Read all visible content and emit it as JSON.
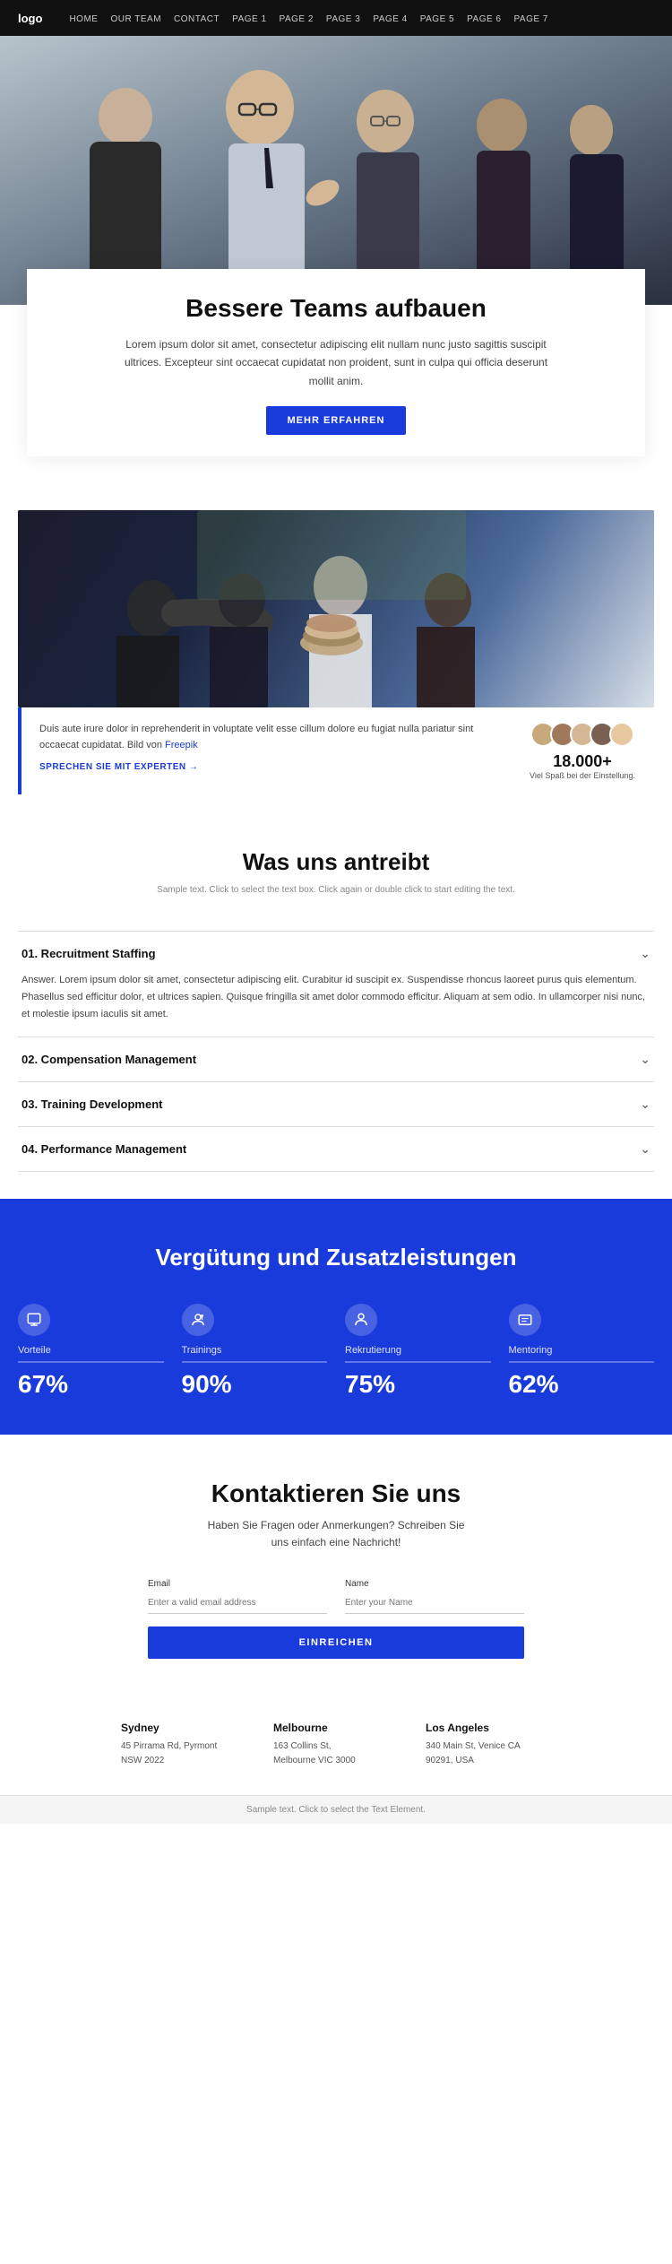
{
  "navbar": {
    "logo": "logo",
    "links": [
      {
        "id": "home",
        "label": "HOME"
      },
      {
        "id": "our-team",
        "label": "OUR TEAM"
      },
      {
        "id": "contact",
        "label": "CONTACT"
      },
      {
        "id": "page1",
        "label": "PAGE 1"
      },
      {
        "id": "page2",
        "label": "PAGE 2"
      },
      {
        "id": "page3",
        "label": "PAGE 3"
      },
      {
        "id": "page4",
        "label": "PAGE 4"
      },
      {
        "id": "page5",
        "label": "PAGE 5"
      },
      {
        "id": "page6",
        "label": "PAGE 6"
      },
      {
        "id": "page7",
        "label": "PAGE 7"
      }
    ]
  },
  "hero": {
    "title": "Bessere Teams aufbauen",
    "description": "Lorem ipsum dolor sit amet, consectetur adipiscing elit nullam nunc justo sagittis suscipit ultrices. Excepteur sint occaecat cupidatat non proident, sunt in culpa qui officia deserunt mollit anim.",
    "cta_button": "MEHR ERFAHREN"
  },
  "teamwork": {
    "stats_text": "Duis aute irure dolor in reprehenderit in voluptate velit esse cillum dolore eu fugiat nulla pariatur sint occaecat cupidatat. Bild von ",
    "stats_link_text": "Freepik",
    "cta_link": "SPRECHEN SIE MIT EXPERTEN →",
    "number": "18.000+",
    "number_label": "Viel Spaß bei der Einstellung."
  },
  "was_section": {
    "title": "Was uns antreibt",
    "sample_text": "Sample text. Click to select the text box. Click again or double click to start editing the text.",
    "accordion": [
      {
        "id": "item1",
        "title": "01. Recruitment Staffing",
        "open": true,
        "body": "Answer. Lorem ipsum dolor sit amet, consectetur adipiscing elit. Curabitur id suscipit ex. Suspendisse rhoncus laoreet purus quis elementum. Phasellus sed efficitur dolor, et ultrices sapien. Quisque fringilla sit amet dolor commodo efficitur. Aliquam at sem odio. In ullamcorper nisi nunc, et molestie ipsum iaculis sit amet."
      },
      {
        "id": "item2",
        "title": "02. Compensation Management",
        "open": false,
        "body": ""
      },
      {
        "id": "item3",
        "title": "03. Training Development",
        "open": false,
        "body": ""
      },
      {
        "id": "item4",
        "title": "04. Performance Management",
        "open": false,
        "body": ""
      }
    ]
  },
  "benefits": {
    "title": "Vergütung und Zusatzleistungen",
    "items": [
      {
        "id": "vorteile",
        "label": "Vorteile",
        "percent": "67%",
        "icon": "check"
      },
      {
        "id": "trainings",
        "label": "Trainings",
        "percent": "90%",
        "icon": "training"
      },
      {
        "id": "rekrutierung",
        "label": "Rekrutierung",
        "percent": "75%",
        "icon": "person"
      },
      {
        "id": "mentoring",
        "label": "Mentoring",
        "percent": "62%",
        "icon": "mentoring"
      }
    ]
  },
  "contact": {
    "title": "Kontaktieren Sie uns",
    "subtitle": "Haben Sie Fragen oder Anmerkungen? Schreiben Sie uns einfach eine Nachricht!",
    "email_label": "Email",
    "email_placeholder": "Enter a valid email address",
    "name_label": "Name",
    "name_placeholder": "Enter your Name",
    "submit_button": "EINREICHEN",
    "offices": [
      {
        "city": "Sydney",
        "address": "45 Pirrama Rd, Pyrmont\nNSW 2022"
      },
      {
        "city": "Melbourne",
        "address": "163 Collins St,\nMelbourne VIC 3000"
      },
      {
        "city": "Los Angeles",
        "address": "340 Main St, Venice CA\n90291, USA"
      }
    ]
  },
  "footer": {
    "note": "Sample text. Click to select the Text Element."
  }
}
